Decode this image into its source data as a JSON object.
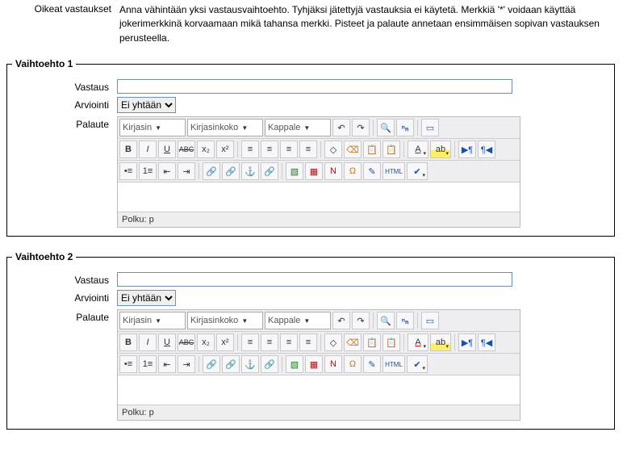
{
  "intro": {
    "label": "Oikeat vastaukset",
    "text": "Anna vähintään yksi vastausvaihtoehto. Tyhjäksi jätettyjä vastauksia ei käytetä. Merkkiä '*' voidaan käyttää jokerimerkkinä korvaamaan mikä tahansa merkki. Pisteet ja palaute annetaan ensimmäisen sopivan vastauksen perusteella."
  },
  "labels": {
    "answer": "Vastaus",
    "grade": "Arviointi",
    "feedback": "Palaute"
  },
  "option1": {
    "legend": "Vaihtoehto 1",
    "answer": "",
    "grade": "Ei yhtään",
    "editor": {
      "font": "Kirjasin",
      "size": "Kirjasinkoko",
      "format": "Kappale",
      "path": "Polku: p"
    }
  },
  "option2": {
    "legend": "Vaihtoehto 2",
    "answer": "",
    "grade": "Ei yhtään",
    "editor": {
      "font": "Kirjasin",
      "size": "Kirjasinkoko",
      "format": "Kappale",
      "path": "Polku: p"
    }
  },
  "icons": {
    "bold": "B",
    "italic": "I",
    "underline": "U",
    "strike": "ABC",
    "sub": "x₂",
    "sup": "x²",
    "alignl": "≡",
    "alignc": "≡",
    "alignr": "≡",
    "alignj": "≡",
    "clean": "◇",
    "clean2": "⌫",
    "paste1": "📋",
    "paste2": "📋",
    "fontcolor": "A",
    "highlight": "ab",
    "ltr": "▶¶",
    "rtl": "¶◀",
    "ul": "•≡",
    "ol": "1≡",
    "outdent": "⇤",
    "indent": "⇥",
    "link": "🔗",
    "unlink": "🔗",
    "anchor": "⚓",
    "nolink": "🔗",
    "image": "▧",
    "table": "▦",
    "line": "N",
    "omega": "Ω",
    "edit": "✎",
    "html": "HTML",
    "spell": "✔",
    "undo": "↶",
    "redo": "↷",
    "find": "🔍",
    "findrep": "ⁿₙ",
    "fullscreen": "▭"
  }
}
